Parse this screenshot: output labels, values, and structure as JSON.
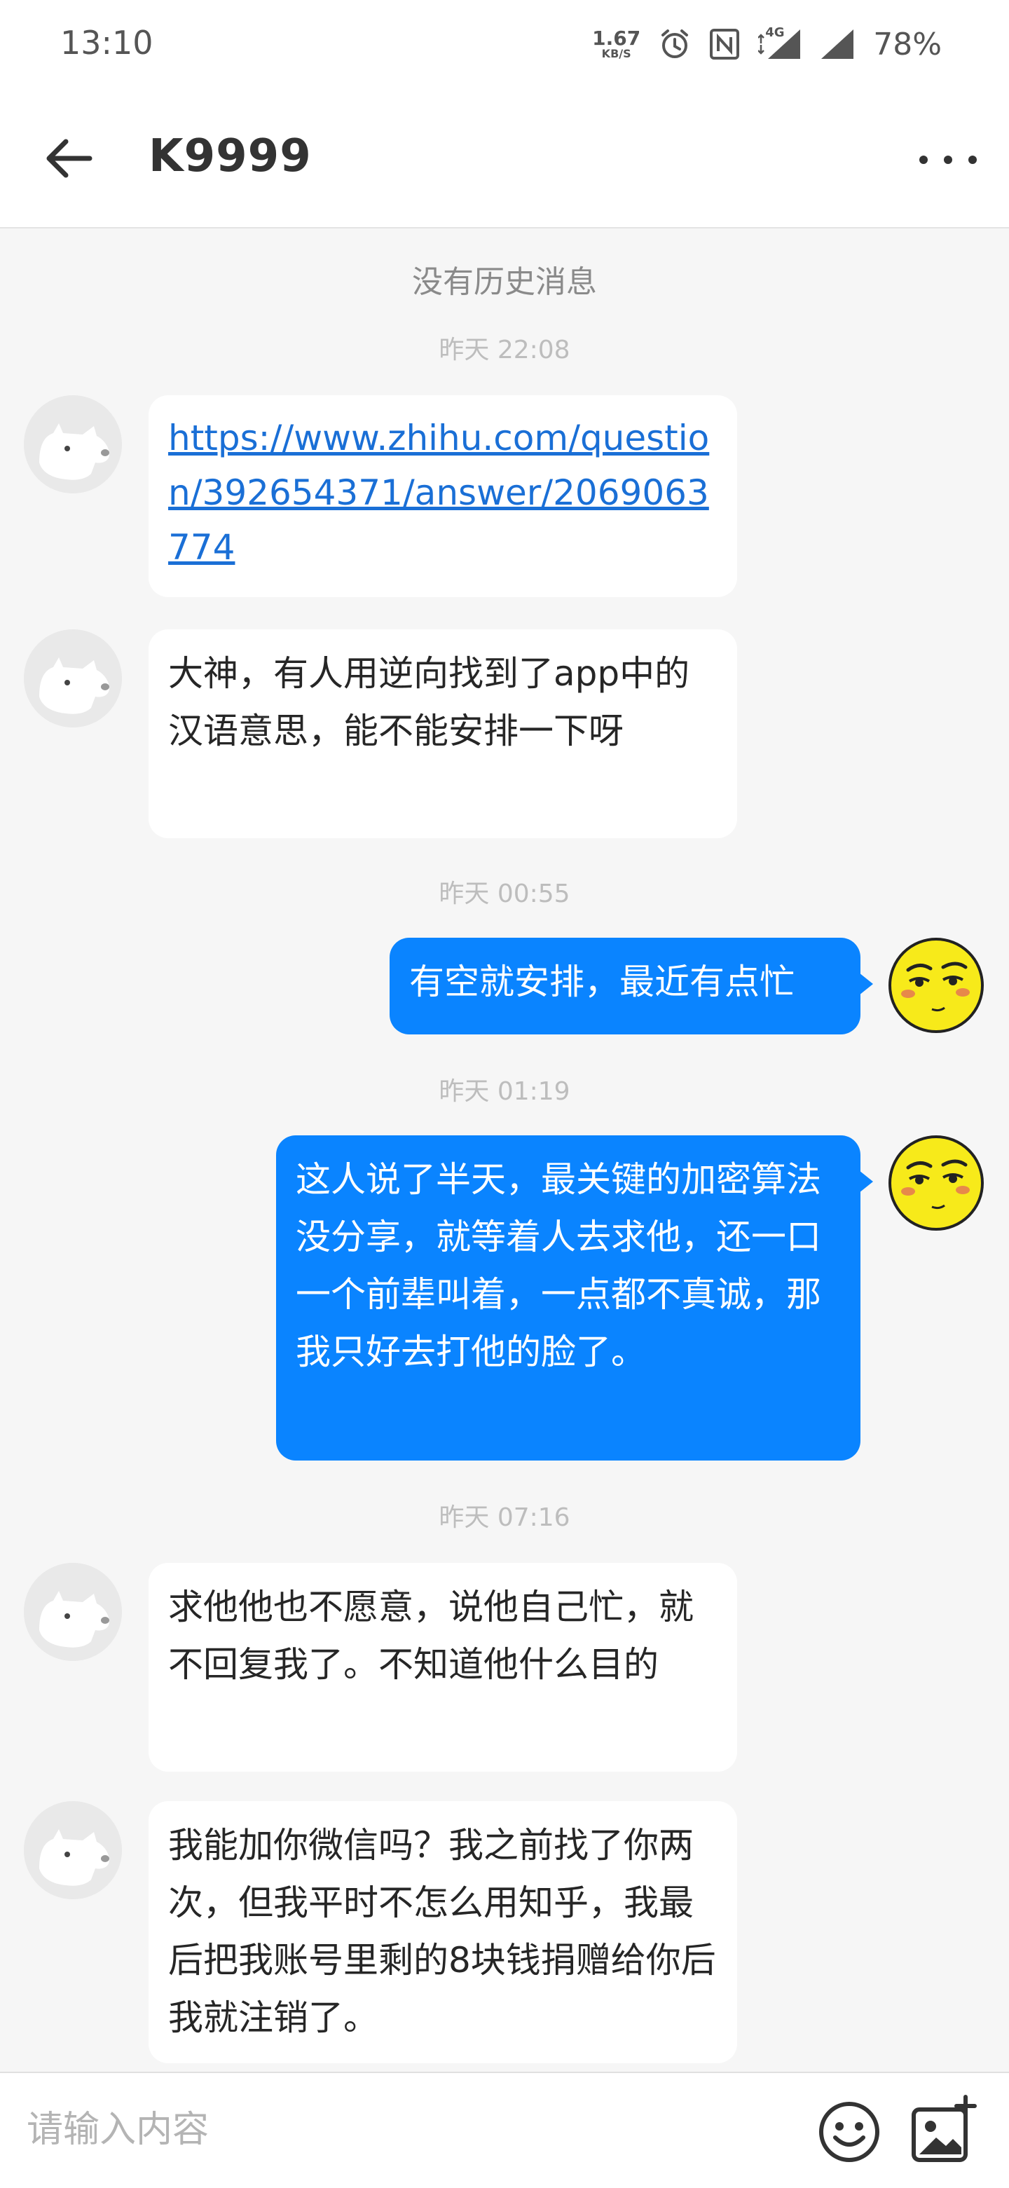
{
  "status_bar": {
    "time": "13:10",
    "net_speed_value": "1.67",
    "net_speed_unit": "KB/S",
    "signal_label": "4G",
    "battery": "78%",
    "icons": [
      "alarm-icon",
      "nfc-icon",
      "signal-4g-icon",
      "signal-icon"
    ]
  },
  "header": {
    "title": "K9999",
    "back_icon": "arrow-left-icon",
    "more_icon": "more-horizontal-icon"
  },
  "messages": {
    "notice": "没有历史消息",
    "items": [
      {
        "type": "time",
        "text": "昨天 22:08"
      },
      {
        "type": "in",
        "avatar": "dog-avatar",
        "text": "https://www.zhihu.com/question/392654371/answer/2069063774",
        "is_link": true
      },
      {
        "type": "in",
        "avatar": "dog-avatar",
        "text": "大神，有人用逆向找到了app中的汉语意思，能不能安排一下呀"
      },
      {
        "type": "time",
        "text": "昨天 00:55"
      },
      {
        "type": "out",
        "avatar": "face-avatar",
        "text": "有空就安排，最近有点忙"
      },
      {
        "type": "time",
        "text": "昨天 01:19"
      },
      {
        "type": "out",
        "avatar": "face-avatar",
        "text": "这人说了半天，最关键的加密算法没分享，就等着人去求他，还一口一个前辈叫着，一点都不真诚，那我只好去打他的脸了。"
      },
      {
        "type": "time",
        "text": "昨天 07:16"
      },
      {
        "type": "in",
        "avatar": "dog-avatar",
        "text": "求他他也不愿意，说他自己忙，就不回复我了。不知道他什么目的"
      },
      {
        "type": "in",
        "avatar": "dog-avatar",
        "text": "我能加你微信吗？我之前找了你两次，但我平时不怎么用知乎，我最后把我账号里剩的8块钱捐赠给你后我就注销了。"
      }
    ]
  },
  "input_bar": {
    "placeholder": "请输入内容",
    "value": "",
    "emoji_icon": "emoji-icon",
    "image_icon": "add-image-icon"
  },
  "colors": {
    "outgoing_bubble": "#0a84ff",
    "incoming_bubble": "#ffffff",
    "background": "#f6f6f6",
    "link": "#1a6fd6"
  }
}
